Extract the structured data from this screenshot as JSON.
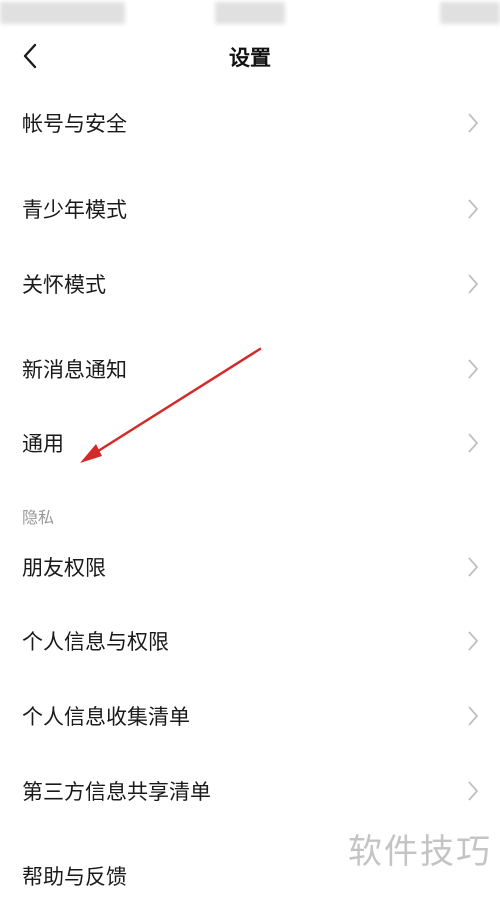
{
  "header": {
    "title": "设置",
    "back_icon": "chevron-left-icon"
  },
  "items": [
    {
      "label": "帐号与安全"
    },
    {
      "label": "青少年模式"
    },
    {
      "label": "关怀模式"
    },
    {
      "label": "新消息通知"
    },
    {
      "label": "通用"
    }
  ],
  "privacy": {
    "section_title": "隐私",
    "items": [
      {
        "label": "朋友权限"
      },
      {
        "label": "个人信息与权限"
      },
      {
        "label": "个人信息收集清单"
      },
      {
        "label": "第三方信息共享清单"
      },
      {
        "label": "帮助与反馈"
      }
    ]
  },
  "watermark": "软件技巧",
  "colors": {
    "background": "#ffffff",
    "text": "#1a1a1a",
    "section_header": "#9a9a9a",
    "chevron": "#c0c0c0",
    "annotation_arrow": "#d42a2a"
  }
}
